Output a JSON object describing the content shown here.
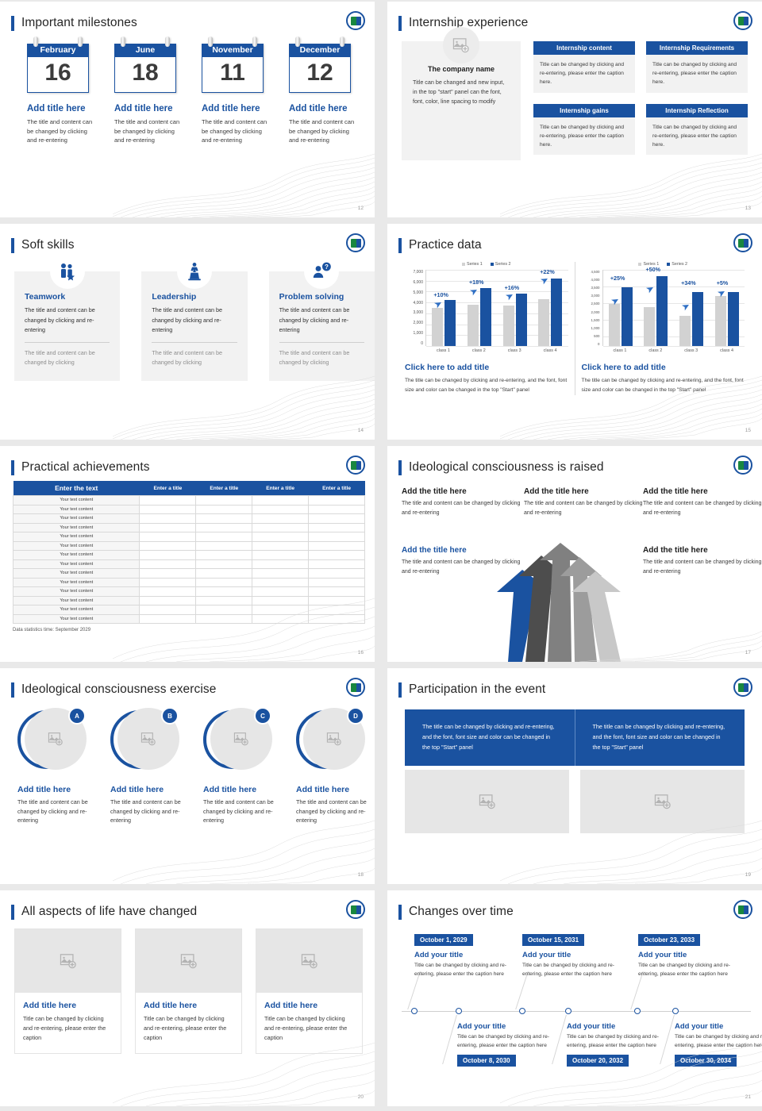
{
  "theme": {
    "blue": "#1a52a0",
    "gray_fill": "#f2f2f2",
    "placeholder_gray": "#e6e6e6"
  },
  "slides": [
    {
      "page": "12",
      "title": "Important milestones",
      "milestones": [
        {
          "month": "February",
          "day": "16",
          "title": "Add title here",
          "desc": "The title and content can be changed by clicking and re-entering"
        },
        {
          "month": "June",
          "day": "18",
          "title": "Add title here",
          "desc": "The title and content can be changed by clicking and re-entering"
        },
        {
          "month": "November",
          "day": "11",
          "title": "Add title here",
          "desc": "The title and content can be changed by clicking and re-entering"
        },
        {
          "month": "December",
          "day": "12",
          "title": "Add title here",
          "desc": "The title and content can be changed by clicking and re-entering"
        }
      ]
    },
    {
      "page": "13",
      "title": "Internship experience",
      "company": {
        "name": "The company name",
        "desc": "Title can be changed and new input, in the top \"start\" panel can the font, font, color, line spacing to modify"
      },
      "boxes": [
        {
          "header": "Internship content",
          "body": "Title can be changed by clicking and re-entering, please enter the caption here."
        },
        {
          "header": "Internship Requirements",
          "body": "Title can be changed by clicking and re-entering, please enter the caption here."
        },
        {
          "header": "Internship gains",
          "body": "Title can be changed by clicking and re-entering, please enter the caption here."
        },
        {
          "header": "Internship Reflection",
          "body": "Title can be changed by clicking and re-entering, please enter the caption here."
        }
      ]
    },
    {
      "page": "14",
      "title": "Soft skills",
      "skills": [
        {
          "icon": "team-people-star-icon",
          "title": "Teamwork",
          "desc": "The title and content can be changed by clicking and re-entering",
          "desc2": "The title and content can be changed by clicking"
        },
        {
          "icon": "speaker-podium-icon",
          "title": "Leadership",
          "desc": "The title and content can be changed by clicking and re-entering",
          "desc2": "The title and content can be changed by clicking"
        },
        {
          "icon": "person-question-icon",
          "title": "Problem solving",
          "desc": "The title and content can be changed by clicking and re-entering",
          "desc2": "The title and content can be changed by clicking"
        }
      ]
    },
    {
      "page": "15",
      "title": "Practice data",
      "panes": [
        {
          "title": "Click here to add title",
          "desc": "The title can be changed by clicking and re-entering, and the font, font size and color can be changed in the top \"Start\" panel"
        },
        {
          "title": "Click here to add title",
          "desc": "The title can be changed by clicking and re-entering, and the font, font size and color can be changed in the top \"Start\" panel"
        }
      ]
    },
    {
      "page": "16",
      "title": "Practical achievements",
      "table": {
        "headers": [
          "Enter the text",
          "Enter a title",
          "Enter a title",
          "Enter a title",
          "Enter a title"
        ],
        "first_col_value": "Your text content",
        "row_count": 14
      },
      "note": "Data statistics time: September 2029"
    },
    {
      "page": "17",
      "title": "Ideological consciousness is raised",
      "items": [
        {
          "title": "Add the title here",
          "desc": "The title and content can be changed by clicking and re-entering",
          "accent": false
        },
        {
          "title": "Add the title here",
          "desc": "The title and content can be changed by clicking and re-entering",
          "accent": false
        },
        {
          "title": "Add the title here",
          "desc": "The title and content can be changed by clicking and re-entering",
          "accent": false
        },
        {
          "title": "Add the title here",
          "desc": "The title and content can be changed by clicking and re-entering",
          "accent": true
        },
        {
          "title": "Add the title here",
          "desc": "The title and content can be changed by clicking and re-entering",
          "accent": false
        }
      ]
    },
    {
      "page": "18",
      "title": "Ideological consciousness exercise",
      "items": [
        {
          "badge": "A",
          "title": "Add title here",
          "desc": "The title and content can be changed by clicking and re-entering"
        },
        {
          "badge": "B",
          "title": "Add title here",
          "desc": "The title and content can be changed by clicking and re-entering"
        },
        {
          "badge": "C",
          "title": "Add title here",
          "desc": "The title and content can be changed by clicking and re-entering"
        },
        {
          "badge": "D",
          "title": "Add title here",
          "desc": "The title and content can be changed by clicking and re-entering"
        }
      ]
    },
    {
      "page": "19",
      "title": "Participation in the event",
      "panels": [
        "The title can be changed by clicking and re-entering, and the font, font size and color can be changed in the top \"Start\" panel",
        "The title can be changed by clicking and re-entering, and the font, font size and color can be changed in the top \"Start\" panel"
      ]
    },
    {
      "page": "20",
      "title": "All aspects of life have changed",
      "cards": [
        {
          "title": "Add title here",
          "desc": "Title can be changed by clicking and re-entering, please enter the caption"
        },
        {
          "title": "Add title here",
          "desc": "Title can be changed by clicking and re-entering, please enter the caption"
        },
        {
          "title": "Add title here",
          "desc": "Title can be changed by clicking and re-entering, please enter the caption"
        }
      ]
    },
    {
      "page": "21",
      "title": "Changes over time",
      "timeline_top": [
        {
          "date": "October 1, 2029",
          "title": "Add your title",
          "desc": "Title can be changed by clicking and re-entering, please enter the caption here"
        },
        {
          "date": "October 15, 2031",
          "title": "Add your title",
          "desc": "Title can be changed by clicking and re-entering, please enter the caption here"
        },
        {
          "date": "October 23, 2033",
          "title": "Add your title",
          "desc": "Title can be changed by clicking and re-entering, please enter the caption here"
        }
      ],
      "timeline_bottom": [
        {
          "date": "October 8, 2030",
          "title": "Add your title",
          "desc": "Title can be changed by clicking and re-entering, please enter the caption here"
        },
        {
          "date": "October 20, 2032",
          "title": "Add your title",
          "desc": "Title can be changed by clicking and re-entering, please enter the caption here"
        },
        {
          "date": "October 30, 2034",
          "title": "Add your title",
          "desc": "Title can be changed by clicking and re-entering, please enter the caption here"
        }
      ]
    }
  ],
  "chart_data": [
    {
      "type": "bar",
      "title": "",
      "categories": [
        "class 1",
        "class 2",
        "class 3",
        "class 4"
      ],
      "series": [
        {
          "name": "Series 1",
          "values": [
            3500,
            3800,
            3700,
            4300
          ],
          "color": "#d2d2d2"
        },
        {
          "name": "Series 2",
          "values": [
            4200,
            5300,
            4800,
            6200
          ],
          "color": "#1a52a0"
        }
      ],
      "annotations": [
        "+10%",
        "+18%",
        "+16%",
        "+22%"
      ],
      "ylabel": "",
      "xlabel": "",
      "ylim": [
        0,
        7000
      ],
      "yticks": [
        "7,000",
        "6,000",
        "5,000",
        "4,000",
        "3,000",
        "2,000",
        "1,000",
        "0"
      ],
      "grid": true,
      "legend_position": "top-right"
    },
    {
      "type": "bar",
      "title": "",
      "categories": [
        "class 1",
        "class 2",
        "class 3",
        "class 4"
      ],
      "series": [
        {
          "name": "Series 1",
          "values": [
            2500,
            2300,
            1800,
            2950
          ],
          "color": "#d2d2d2"
        },
        {
          "name": "Series 2",
          "values": [
            3480,
            4150,
            3200,
            3200
          ],
          "color": "#1a52a0"
        }
      ],
      "annotations": [
        "+25%",
        "+50%",
        "+34%",
        "+5%"
      ],
      "ylabel": "",
      "xlabel": "",
      "ylim": [
        0,
        4500
      ],
      "yticks": [
        "4,500",
        "4,000",
        "3,500",
        "3,000",
        "2,500",
        "2,000",
        "1,500",
        "1,000",
        "500",
        "0"
      ],
      "grid": true,
      "legend_position": "top-right"
    }
  ]
}
